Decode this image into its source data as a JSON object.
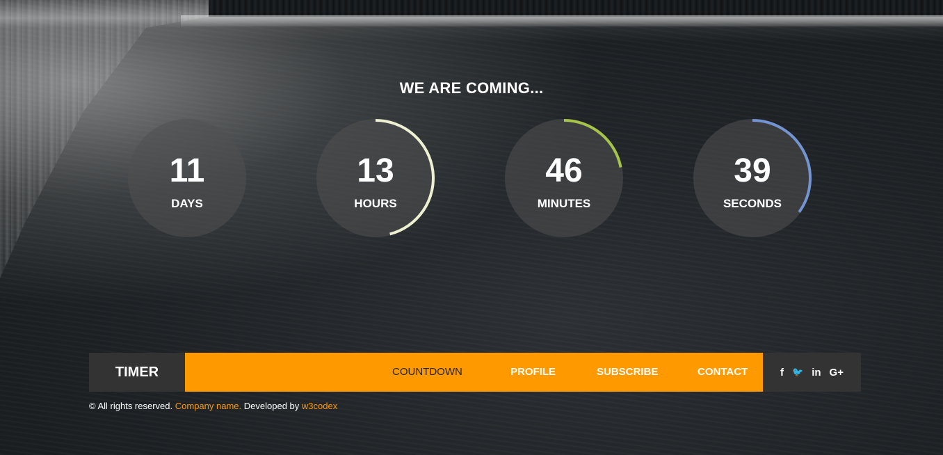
{
  "heading": "WE ARE COMING...",
  "timers": [
    {
      "value": "11",
      "label": "DAYS",
      "progress": 0.0,
      "color": "#ffffff"
    },
    {
      "value": "13",
      "label": "HOURS",
      "progress": 0.46,
      "color": "#eef0d2"
    },
    {
      "value": "46",
      "label": "MINUTES",
      "progress": 0.22,
      "color": "#a7c44a"
    },
    {
      "value": "39",
      "label": "SECONDS",
      "progress": 0.35,
      "color": "#7394d0"
    }
  ],
  "nav": {
    "brand": "TIMER",
    "items": [
      "COUNTDOWN",
      "PROFILE",
      "SUBSCRIBE",
      "CONTACT"
    ],
    "active_index": 0,
    "social": [
      {
        "icon": "facebook-icon",
        "glyph": "f"
      },
      {
        "icon": "twitter-icon",
        "glyph": "🐦"
      },
      {
        "icon": "linkedin-icon",
        "glyph": "in"
      },
      {
        "icon": "google-plus-icon",
        "glyph": "G+"
      }
    ]
  },
  "footer": {
    "copyright": "© All rights reserved.",
    "company": "Company name.",
    "developed_by": "Developed by",
    "developer": "w3codex"
  },
  "colors": {
    "accent": "#ff9900",
    "nav_dark": "#333333"
  }
}
